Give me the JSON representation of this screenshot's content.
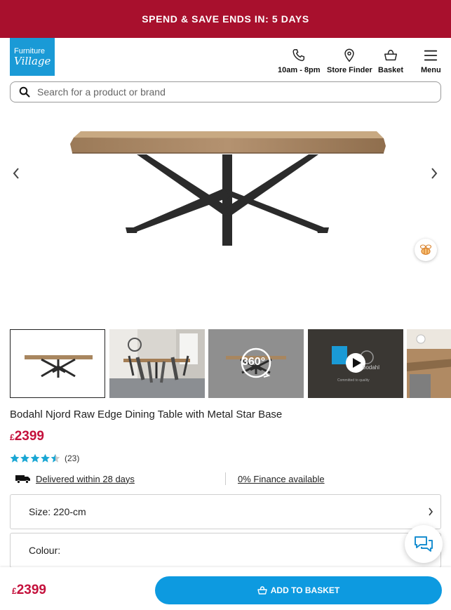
{
  "promo": {
    "text": "SPEND & SAVE ENDS IN: 5 DAYS"
  },
  "logo": {
    "line1": "Furniture",
    "line2": "Village"
  },
  "header": {
    "hours_label": "10am - 8pm",
    "store_finder_label": "Store Finder",
    "basket_label": "Basket",
    "menu_label": "Menu"
  },
  "search": {
    "placeholder": "Search for a product or brand"
  },
  "gallery": {
    "prev_icon": "chevron-left-icon",
    "next_icon": "chevron-right-icon",
    "thumbnails": [
      {
        "name": "table-only"
      },
      {
        "name": "room-scene"
      },
      {
        "name": "360-view",
        "badge": "360°"
      },
      {
        "name": "video",
        "brand": "bodahl",
        "caption": "Committed to quality"
      },
      {
        "name": "detail"
      }
    ]
  },
  "product": {
    "title": "Bodahl Njord Raw Edge Dining Table with Metal Star Base",
    "currency": "£",
    "price": "2399",
    "rating_value": 4.5,
    "rating_count": "(23)",
    "delivery_text": "Delivered within 28 days",
    "finance_text": "0% Finance available"
  },
  "options": {
    "size_label": "Size: 220-cm",
    "colour_label": "Colour:"
  },
  "footer": {
    "currency": "£",
    "price": "2399",
    "add_to_basket_label": "ADD TO BASKET"
  },
  "colors": {
    "promo": "#a8102d",
    "brand_blue": "#1a9ad6",
    "price": "#c4113c",
    "cta": "#0d9ae0",
    "stars": "#1aa7d4"
  }
}
